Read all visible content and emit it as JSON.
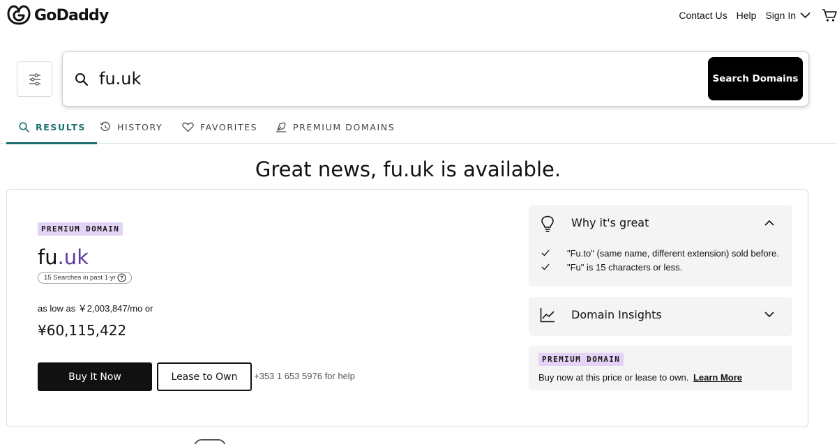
{
  "header": {
    "brand": "GoDaddy",
    "nav": {
      "contact": "Contact Us",
      "help": "Help",
      "signin": "Sign In"
    }
  },
  "search": {
    "query": "fu.uk",
    "button": "Search Domains"
  },
  "tabs": [
    {
      "label": "RESULTS",
      "active": true
    },
    {
      "label": "HISTORY"
    },
    {
      "label": "FAVORITES"
    },
    {
      "label": "PREMIUM DOMAINS"
    }
  ],
  "headline": "Great news, fu.uk is available.",
  "result": {
    "badge": "PREMIUM DOMAIN",
    "sld": "fu",
    "tld": ".uk",
    "search_count": "15 Searches in past 1-yr",
    "low_price": "as low as ￥2,003,847/mo or",
    "price": "¥60,115,422",
    "buy_button": "Buy It Now",
    "lease_button": "Lease to Own",
    "help_phone": "+353 1 653 5976 for help"
  },
  "panels": {
    "why": {
      "title": "Why it's great",
      "reasons": [
        "\"Fu.to\" (same name, different extension) sold before.",
        "\"Fu\" is 15 characters or less."
      ]
    },
    "insights": {
      "title": "Domain Insights"
    },
    "premium": {
      "badge": "PREMIUM DOMAIN",
      "text": "Buy now at this price or lease to own.",
      "link": "Learn More"
    }
  },
  "colors": {
    "accent": "#1b6f70",
    "premium_badge": "#e3d3f6",
    "tld": "#5c3b9c",
    "panel_bg": "#f4f4f5"
  }
}
